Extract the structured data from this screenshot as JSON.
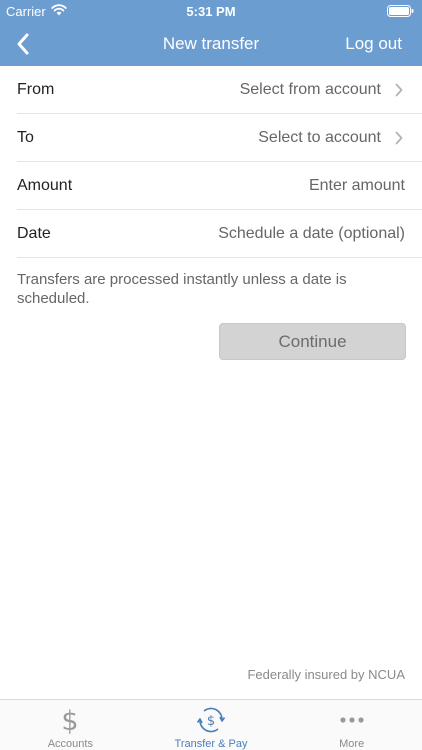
{
  "status_bar": {
    "carrier": "Carrier",
    "time": "5:31 PM"
  },
  "nav": {
    "title": "New transfer",
    "logout_label": "Log out",
    "back_icon": "chevron-left-icon"
  },
  "form": {
    "rows": [
      {
        "label": "From",
        "value": "Select from account",
        "chevron": true
      },
      {
        "label": "To",
        "value": "Select to account",
        "chevron": true
      },
      {
        "label": "Amount",
        "value": "Enter amount",
        "chevron": false
      },
      {
        "label": "Date",
        "value": "Schedule a date (optional)",
        "chevron": false
      }
    ],
    "note": "Transfers are processed instantly unless a date is scheduled.",
    "continue_label": "Continue"
  },
  "footer_note": "Federally insured by NCUA",
  "tabbar": {
    "tabs": [
      {
        "label": "Accounts",
        "icon": "dollar-icon",
        "active": false
      },
      {
        "label": "Transfer & Pay",
        "icon": "transfer-dollar-icon",
        "active": true
      },
      {
        "label": "More",
        "icon": "more-dots-icon",
        "active": false
      }
    ]
  },
  "colors": {
    "header": "#6b9dd1",
    "active_tab": "#4a7fba",
    "button_bg": "#d3d3d3"
  }
}
